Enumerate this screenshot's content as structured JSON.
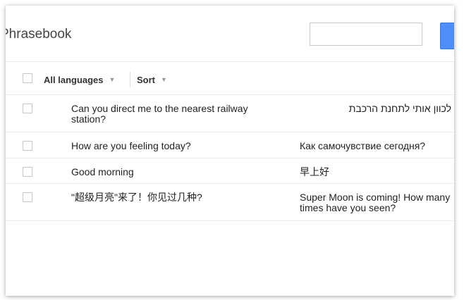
{
  "app": {
    "title": "Phrasebook"
  },
  "search": {
    "value": "",
    "placeholder": ""
  },
  "toolbar": {
    "languages_label": "All languages",
    "sort_label": "Sort"
  },
  "phrases": [
    {
      "source": "Can you direct me to the nearest railway station?",
      "translation": "לכוון אותי לתחנת הרכבת"
    },
    {
      "source": "How are you feeling today?",
      "translation": "Как самочувствие сегодня?"
    },
    {
      "source": "Good morning",
      "translation": "早上好"
    },
    {
      "source": "\"超级月亮\"来了！你见过几种?",
      "translation": "Super Moon is coming! How many times have you seen?"
    }
  ],
  "colors": {
    "accent": "#4d8ef7",
    "title_text": "#444444",
    "divider": "#ebebeb"
  },
  "icons": {
    "dropdown": "caret-down-icon"
  }
}
